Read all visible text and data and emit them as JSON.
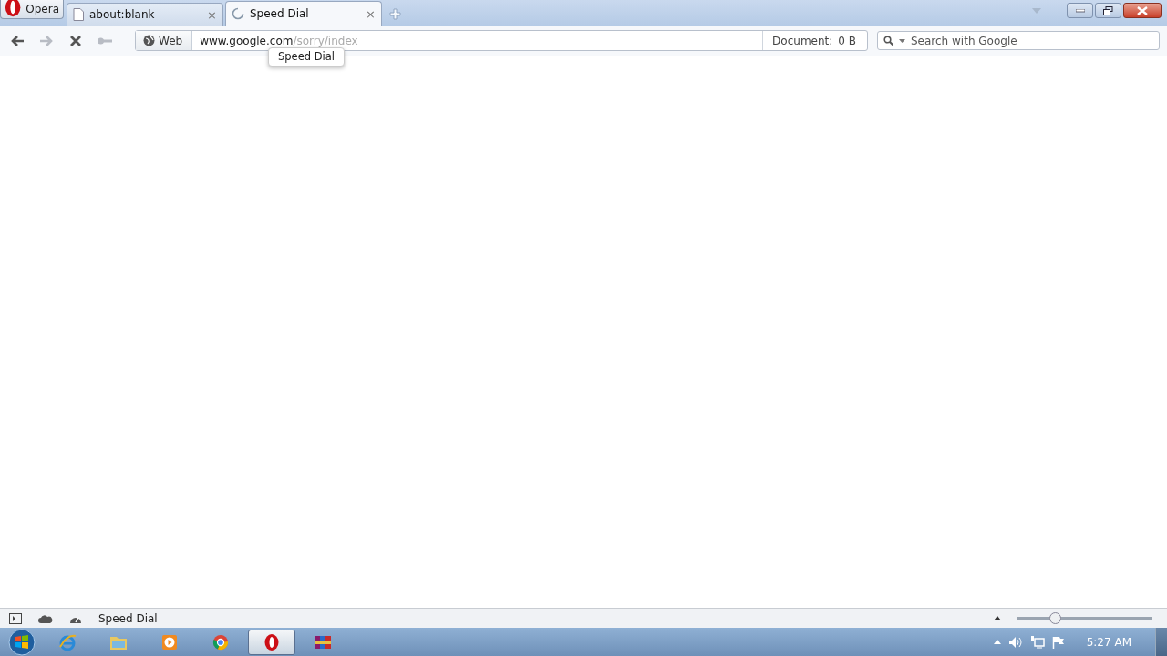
{
  "menu_button": {
    "label": "Opera"
  },
  "tabs": [
    {
      "title": "about:blank",
      "selected": false,
      "loading": false,
      "close": "×"
    },
    {
      "title": "Speed Dial",
      "selected": true,
      "loading": true,
      "close": "×"
    }
  ],
  "tooltip": "Speed Dial",
  "toolbar": {
    "back_disabled": false,
    "forward_disabled": true,
    "stop_disabled": false,
    "key_disabled": true
  },
  "address": {
    "badge": "Web",
    "host": "www.google.com",
    "path": "/sorry/index"
  },
  "document_size": {
    "label": "Document:",
    "value": "0 B"
  },
  "search": {
    "placeholder": "Search with Google"
  },
  "status_bar": {
    "text": "Speed Dial",
    "zoom": {
      "level": 0.28
    }
  },
  "taskbar": {
    "apps": [
      {
        "kind": "ie",
        "selected": false
      },
      {
        "kind": "explorer",
        "selected": false
      },
      {
        "kind": "media",
        "selected": false
      },
      {
        "kind": "chrome",
        "selected": false
      },
      {
        "kind": "opera",
        "selected": true
      },
      {
        "kind": "archiver",
        "selected": false
      }
    ],
    "clock": "5:27 AM"
  }
}
